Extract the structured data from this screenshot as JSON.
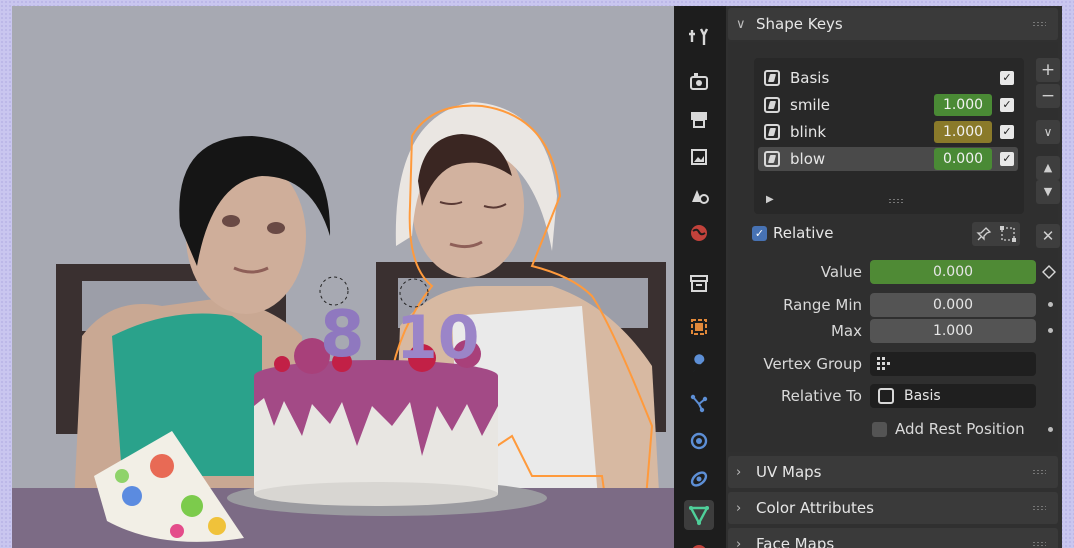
{
  "shape_keys_panel": {
    "title": "Shape Keys",
    "keys": [
      {
        "name": "Basis",
        "value": "",
        "value_color": "",
        "checked": true,
        "active": false
      },
      {
        "name": "smile",
        "value": "1.000",
        "value_color": "#4a8a35",
        "checked": true,
        "active": false
      },
      {
        "name": "blink",
        "value": "1.000",
        "value_color": "#8a7a2a",
        "checked": true,
        "active": false
      },
      {
        "name": "blow",
        "value": "0.000",
        "value_color": "#4a8a35",
        "checked": true,
        "active": true
      }
    ],
    "relative_label": "Relative",
    "value_label": "Value",
    "value": "0.000",
    "range_min_label": "Range Min",
    "range_min": "0.000",
    "max_label": "Max",
    "max": "1.000",
    "vertex_group_label": "Vertex Group",
    "vertex_group": "",
    "relative_to_label": "Relative To",
    "relative_to": "Basis",
    "add_rest_label": "Add Rest Position"
  },
  "collapsed_panels": [
    "UV Maps",
    "Color Attributes",
    "Face Maps"
  ],
  "viewport": {
    "cake_numbers": [
      "8",
      "10"
    ]
  },
  "colors": {
    "value_green": "#4f8a35",
    "panel_bg": "#303030",
    "checkbox_blue": "#4772b3"
  }
}
